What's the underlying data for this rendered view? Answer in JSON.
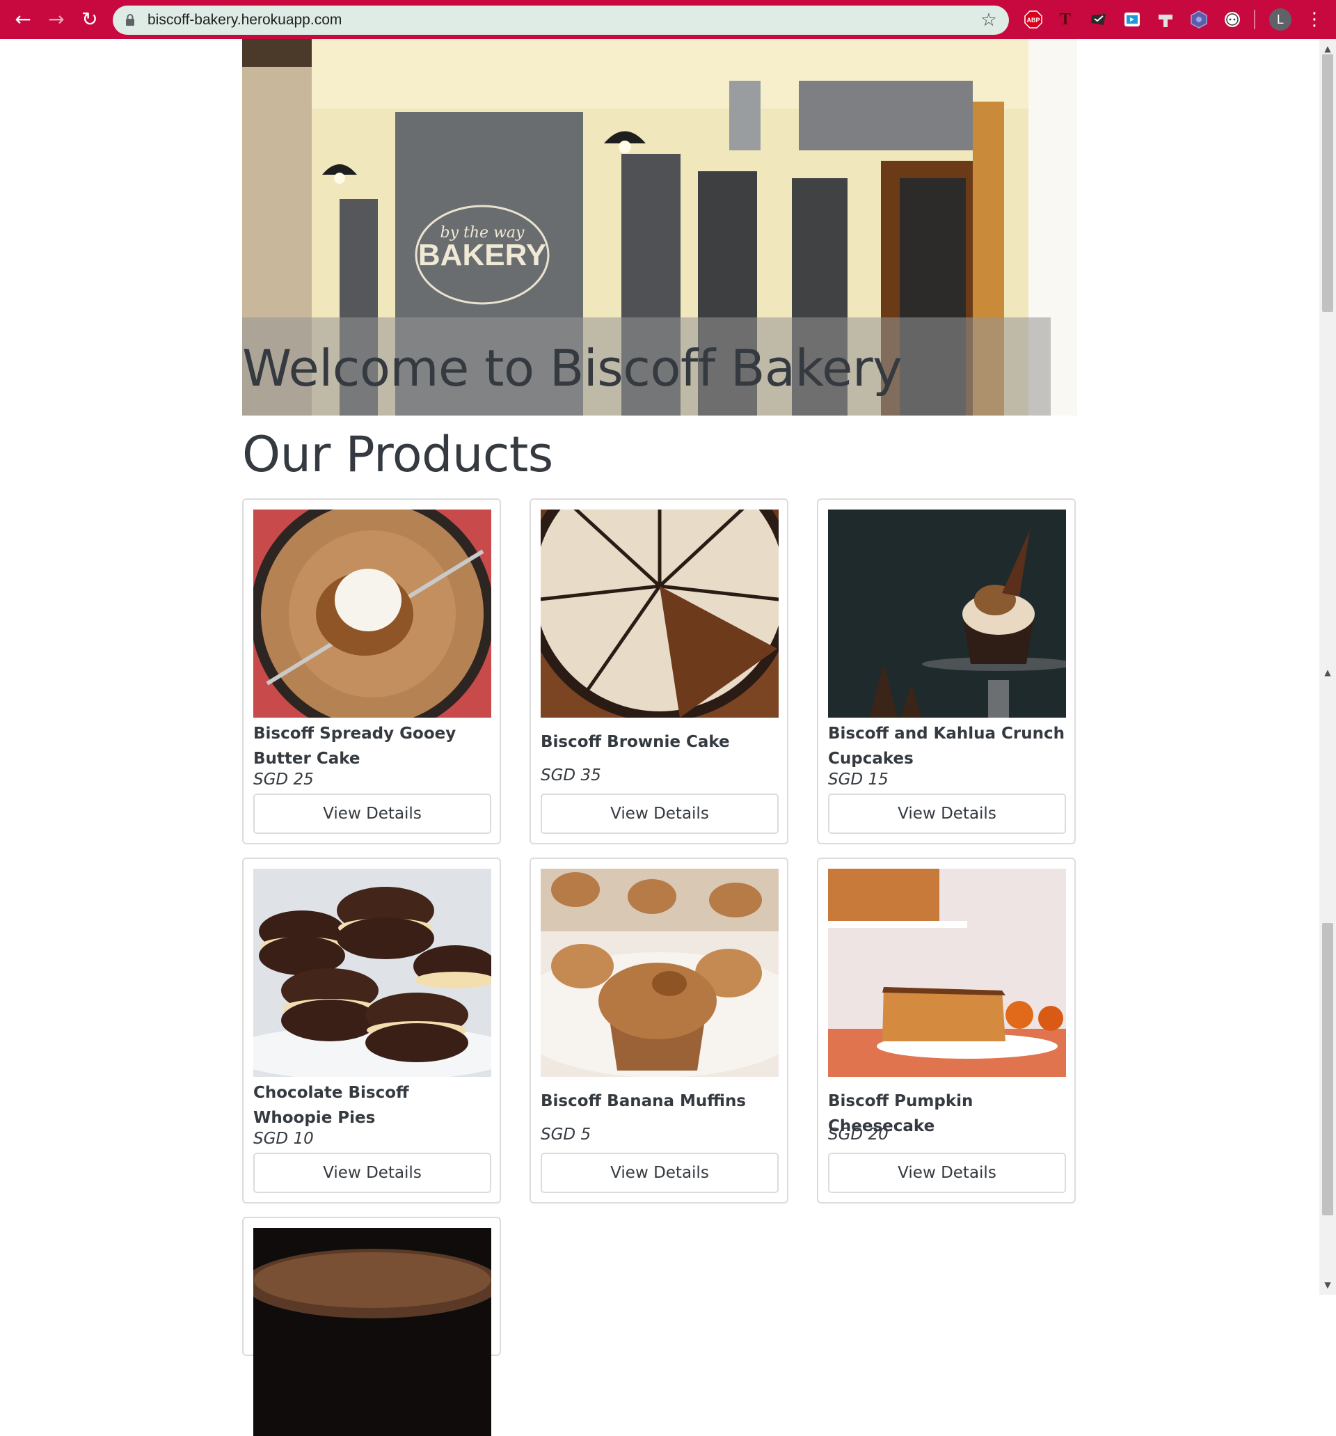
{
  "browser": {
    "url": "biscoff-bakery.herokuapp.com",
    "profile_initial": "L",
    "extensions": [
      "adblock-plus-icon",
      "text-extension-icon",
      "todoist-icon",
      "screencast-icon",
      "pin-extension-icon",
      "hexagon-extension-icon",
      "devtools-extension-icon"
    ],
    "abp_label": "ABP",
    "t_label": "T",
    "theme_color": "#c8093f"
  },
  "hero": {
    "title": "Welcome to Biscoff Bakery",
    "sign_top": "by the way",
    "sign_main": "BAKERY"
  },
  "products_section": {
    "title": "Our Products"
  },
  "products": [
    {
      "name": "Biscoff Spready Gooey Butter Cake",
      "price": "SGD 25",
      "button": "View Details",
      "image": "gooey-butter-cake-photo"
    },
    {
      "name": "Biscoff Brownie Cake",
      "price": "SGD 35",
      "button": "View Details",
      "image": "brownie-cake-photo"
    },
    {
      "name": "Biscoff and Kahlua Crunch Cupcakes",
      "price": "SGD 15",
      "button": "View Details",
      "image": "kahlua-cupcake-photo"
    },
    {
      "name": "Chocolate Biscoff Whoopie Pies",
      "price": "SGD 10",
      "button": "View Details",
      "image": "whoopie-pies-photo"
    },
    {
      "name": "Biscoff Banana Muffins",
      "price": "SGD 5",
      "button": "View Details",
      "image": "banana-muffins-photo"
    },
    {
      "name": "Biscoff Pumpkin Cheesecake",
      "price": "SGD 20",
      "button": "View Details",
      "image": "pumpkin-cheesecake-photo"
    },
    {
      "image": "chocolate-cake-photo"
    }
  ]
}
